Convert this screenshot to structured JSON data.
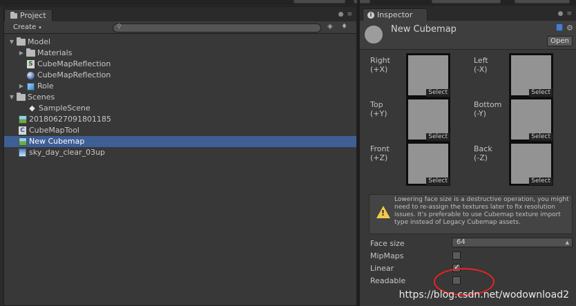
{
  "project": {
    "tab_title": "Project",
    "create_label": "Create",
    "search_placeholder": "",
    "items": [
      {
        "label": "Model",
        "icon": "folder-icon",
        "expanded": true
      },
      {
        "label": "Materials",
        "icon": "folder-icon",
        "expanded": false
      },
      {
        "label": "CubeMapReflection",
        "icon": "script-icon"
      },
      {
        "label": "CubeMapReflection",
        "icon": "material-sphere-icon"
      },
      {
        "label": "Role",
        "icon": "prefab-icon",
        "expanded": false
      },
      {
        "label": "Scenes",
        "icon": "folder-icon",
        "expanded": true
      },
      {
        "label": "SampleScene",
        "icon": "unity-scene-icon"
      },
      {
        "label": "20180627091801185",
        "icon": "cubemap-icon"
      },
      {
        "label": "CubeMapTool",
        "icon": "csharp-script-icon"
      },
      {
        "label": "New Cubemap",
        "icon": "cubemap-icon",
        "selected": true
      },
      {
        "label": "sky_day_clear_03up",
        "icon": "texture-icon"
      }
    ]
  },
  "inspector": {
    "tab_title": "Inspector",
    "asset_name": "New Cubemap",
    "open_label": "Open",
    "faces": [
      {
        "name": "Right",
        "axis": "(+X)",
        "select": "Select"
      },
      {
        "name": "Left",
        "axis": "(-X)",
        "select": "Select"
      },
      {
        "name": "Top",
        "axis": "(+Y)",
        "select": "Select"
      },
      {
        "name": "Bottom",
        "axis": "(-Y)",
        "select": "Select"
      },
      {
        "name": "Front",
        "axis": "(+Z)",
        "select": "Select"
      },
      {
        "name": "Back",
        "axis": "(-Z)",
        "select": "Select"
      }
    ],
    "warning": "Lowering face size is a destructive operation, you might need to re-assign the textures later to fix resolution issues. It's preferable to use Cubemap texture import type instead of Legacy Cubemap assets.",
    "props": {
      "face_size_label": "Face size",
      "face_size_value": "64",
      "mipmaps_label": "MipMaps",
      "mipmaps_checked": false,
      "linear_label": "Linear",
      "linear_checked": true,
      "readable_label": "Readable",
      "readable_checked": false
    }
  },
  "watermark": "https://blog.csdn.net/wodownload2",
  "colors": {
    "selection": "#3e5f96",
    "highlight_ring": "#e22222",
    "warning": "#f2c94c"
  }
}
